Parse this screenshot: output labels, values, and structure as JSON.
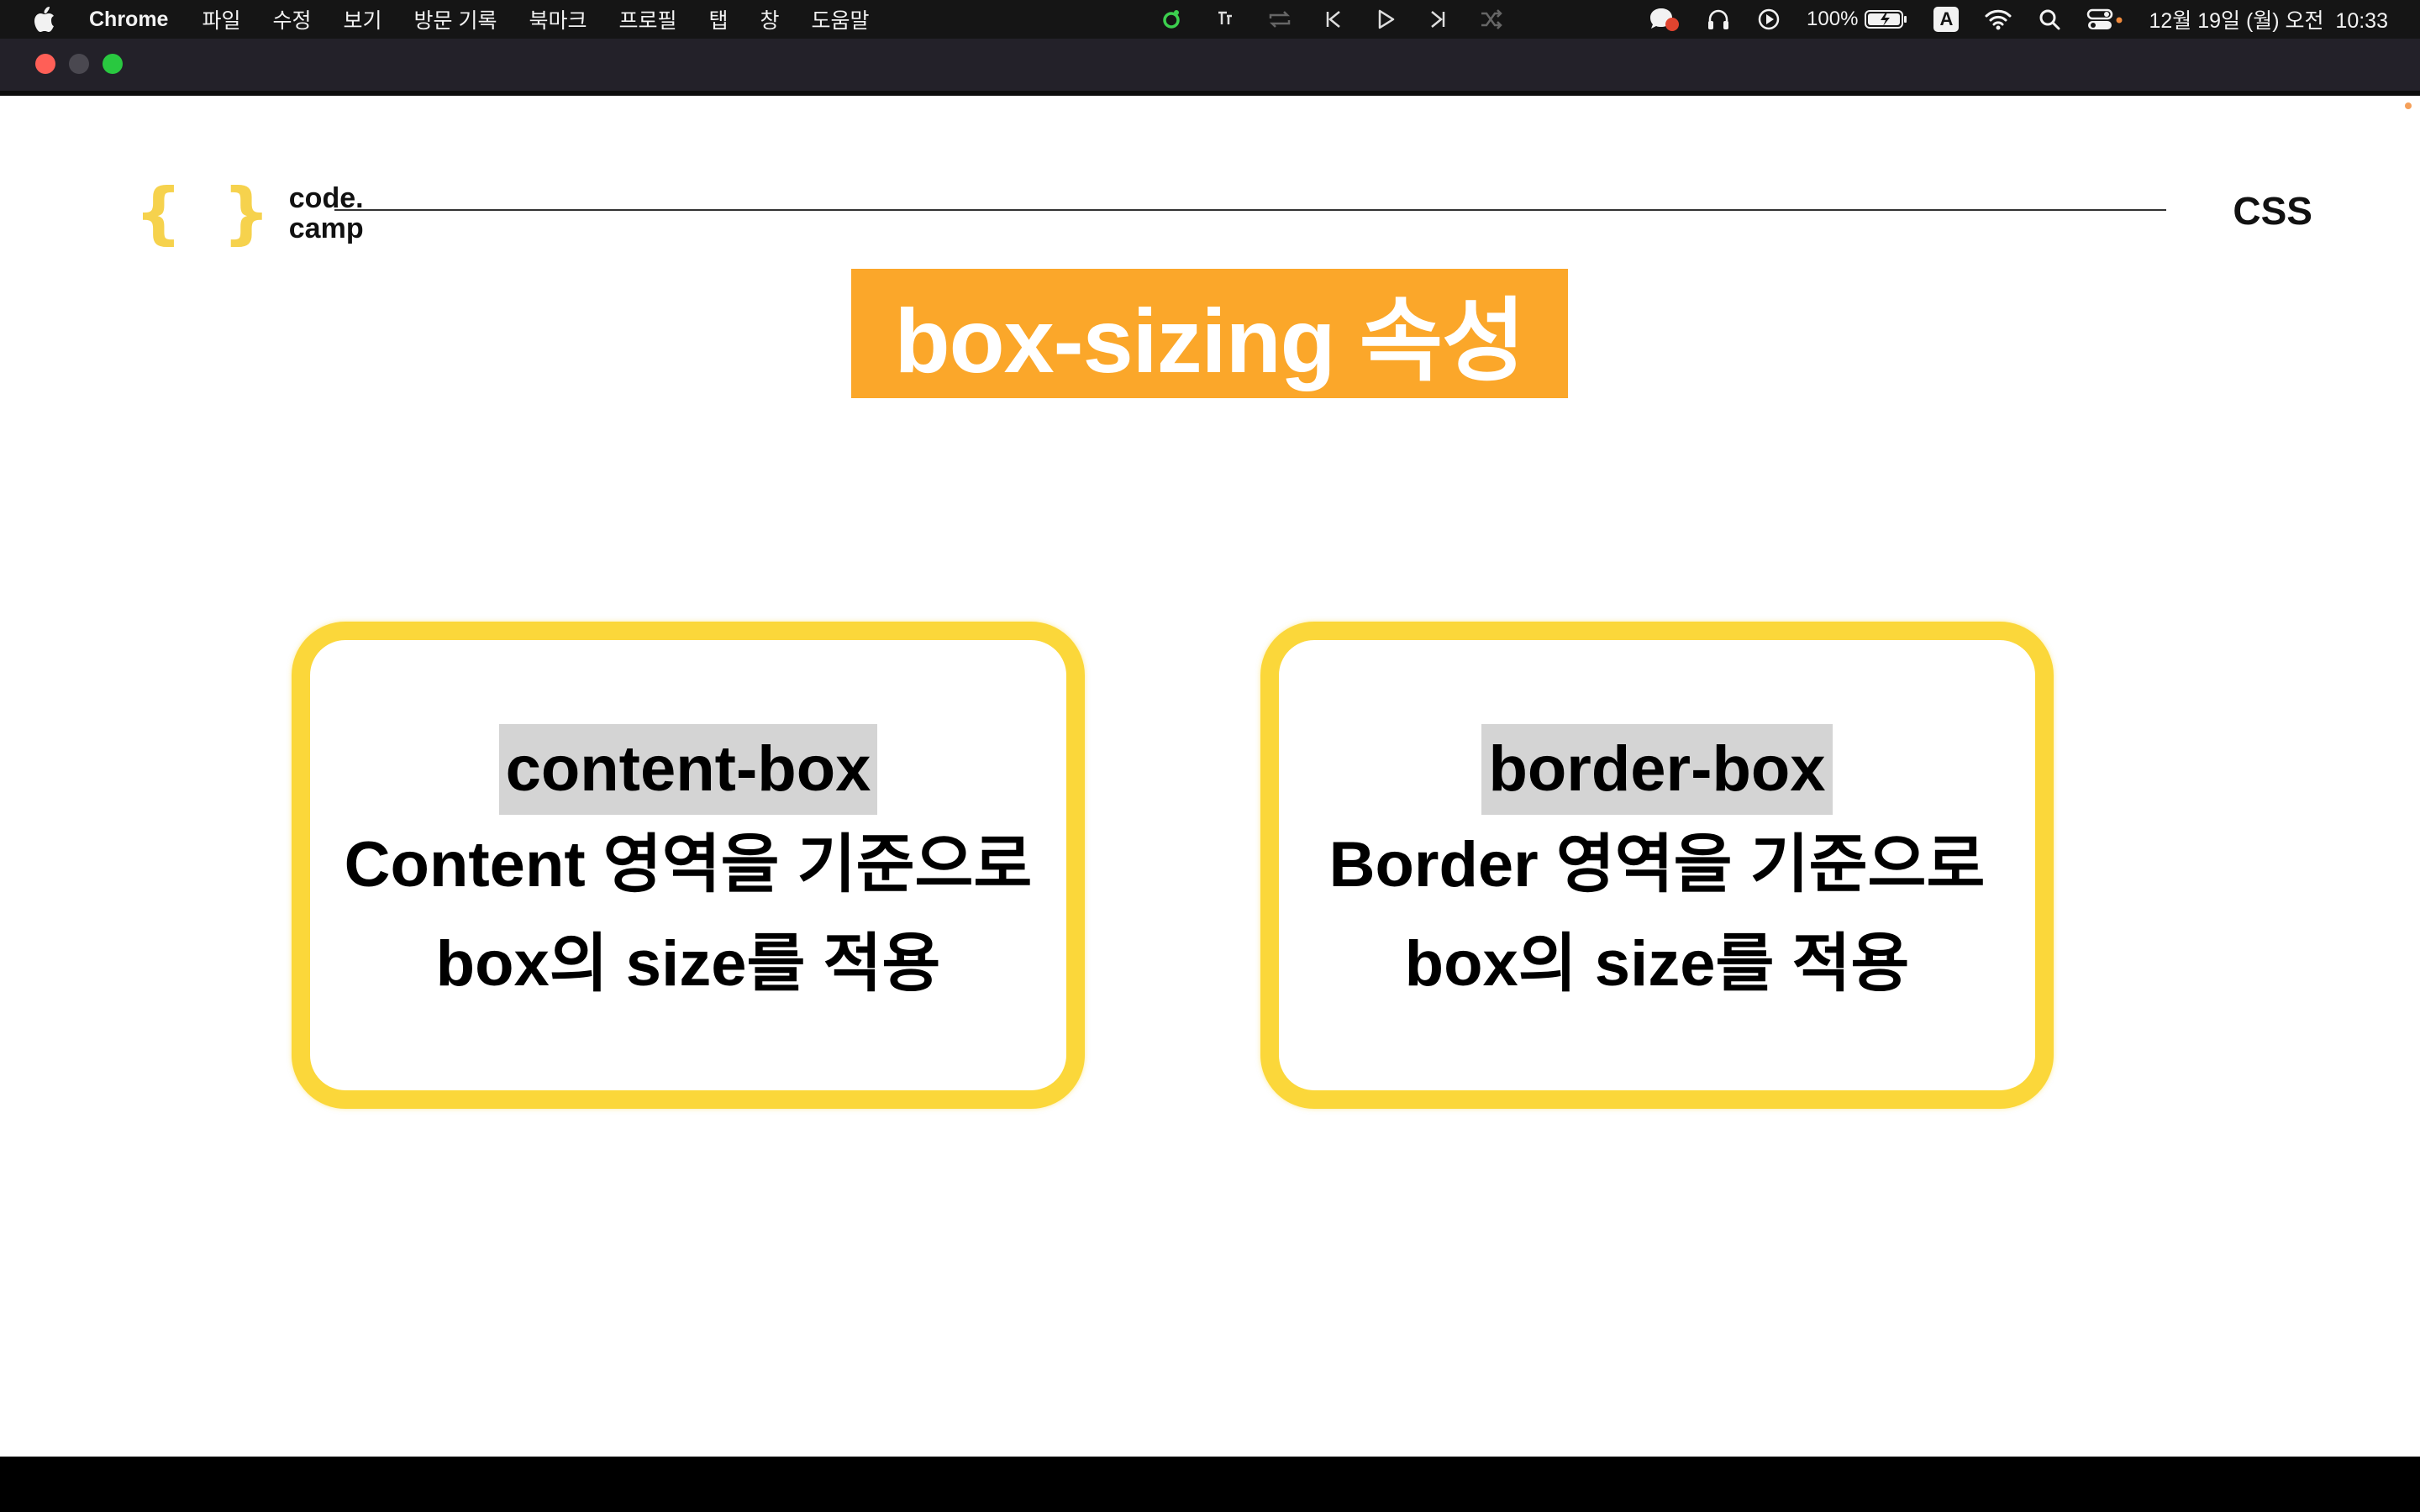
{
  "menubar": {
    "app": "Chrome",
    "items": [
      "파일",
      "수정",
      "보기",
      "방문 기록",
      "북마크",
      "프로필",
      "탭",
      "창",
      "도움말"
    ],
    "battery": "100%",
    "input_source": "A",
    "datetime": "12월 19일 (월) 오전  10:33"
  },
  "slide": {
    "logo": {
      "line1": "code.",
      "line2": "camp"
    },
    "topic": "CSS",
    "title": "box-sizing 속성",
    "cards": [
      {
        "term": "content-box",
        "line1": "Content 영역을 기준으로",
        "line2": "box의 size를 적용"
      },
      {
        "term": "border-box",
        "line1": "Border 영역을 기준으로",
        "line2": "box의 size를 적용"
      }
    ]
  },
  "colors": {
    "title_bg": "#fba72a",
    "card_border": "#fbd73a",
    "term_bg": "#d4d4d4",
    "logo_braces": "#f6d24d"
  },
  "icons": [
    "apple-icon",
    "shazam-icon",
    "repeat-icon",
    "previous-track-icon",
    "play-icon",
    "next-track-icon",
    "shuffle-icon",
    "chat-icon",
    "headphones-icon",
    "play-circle-icon",
    "battery-icon",
    "wifi-icon",
    "search-icon",
    "control-center-icon"
  ]
}
